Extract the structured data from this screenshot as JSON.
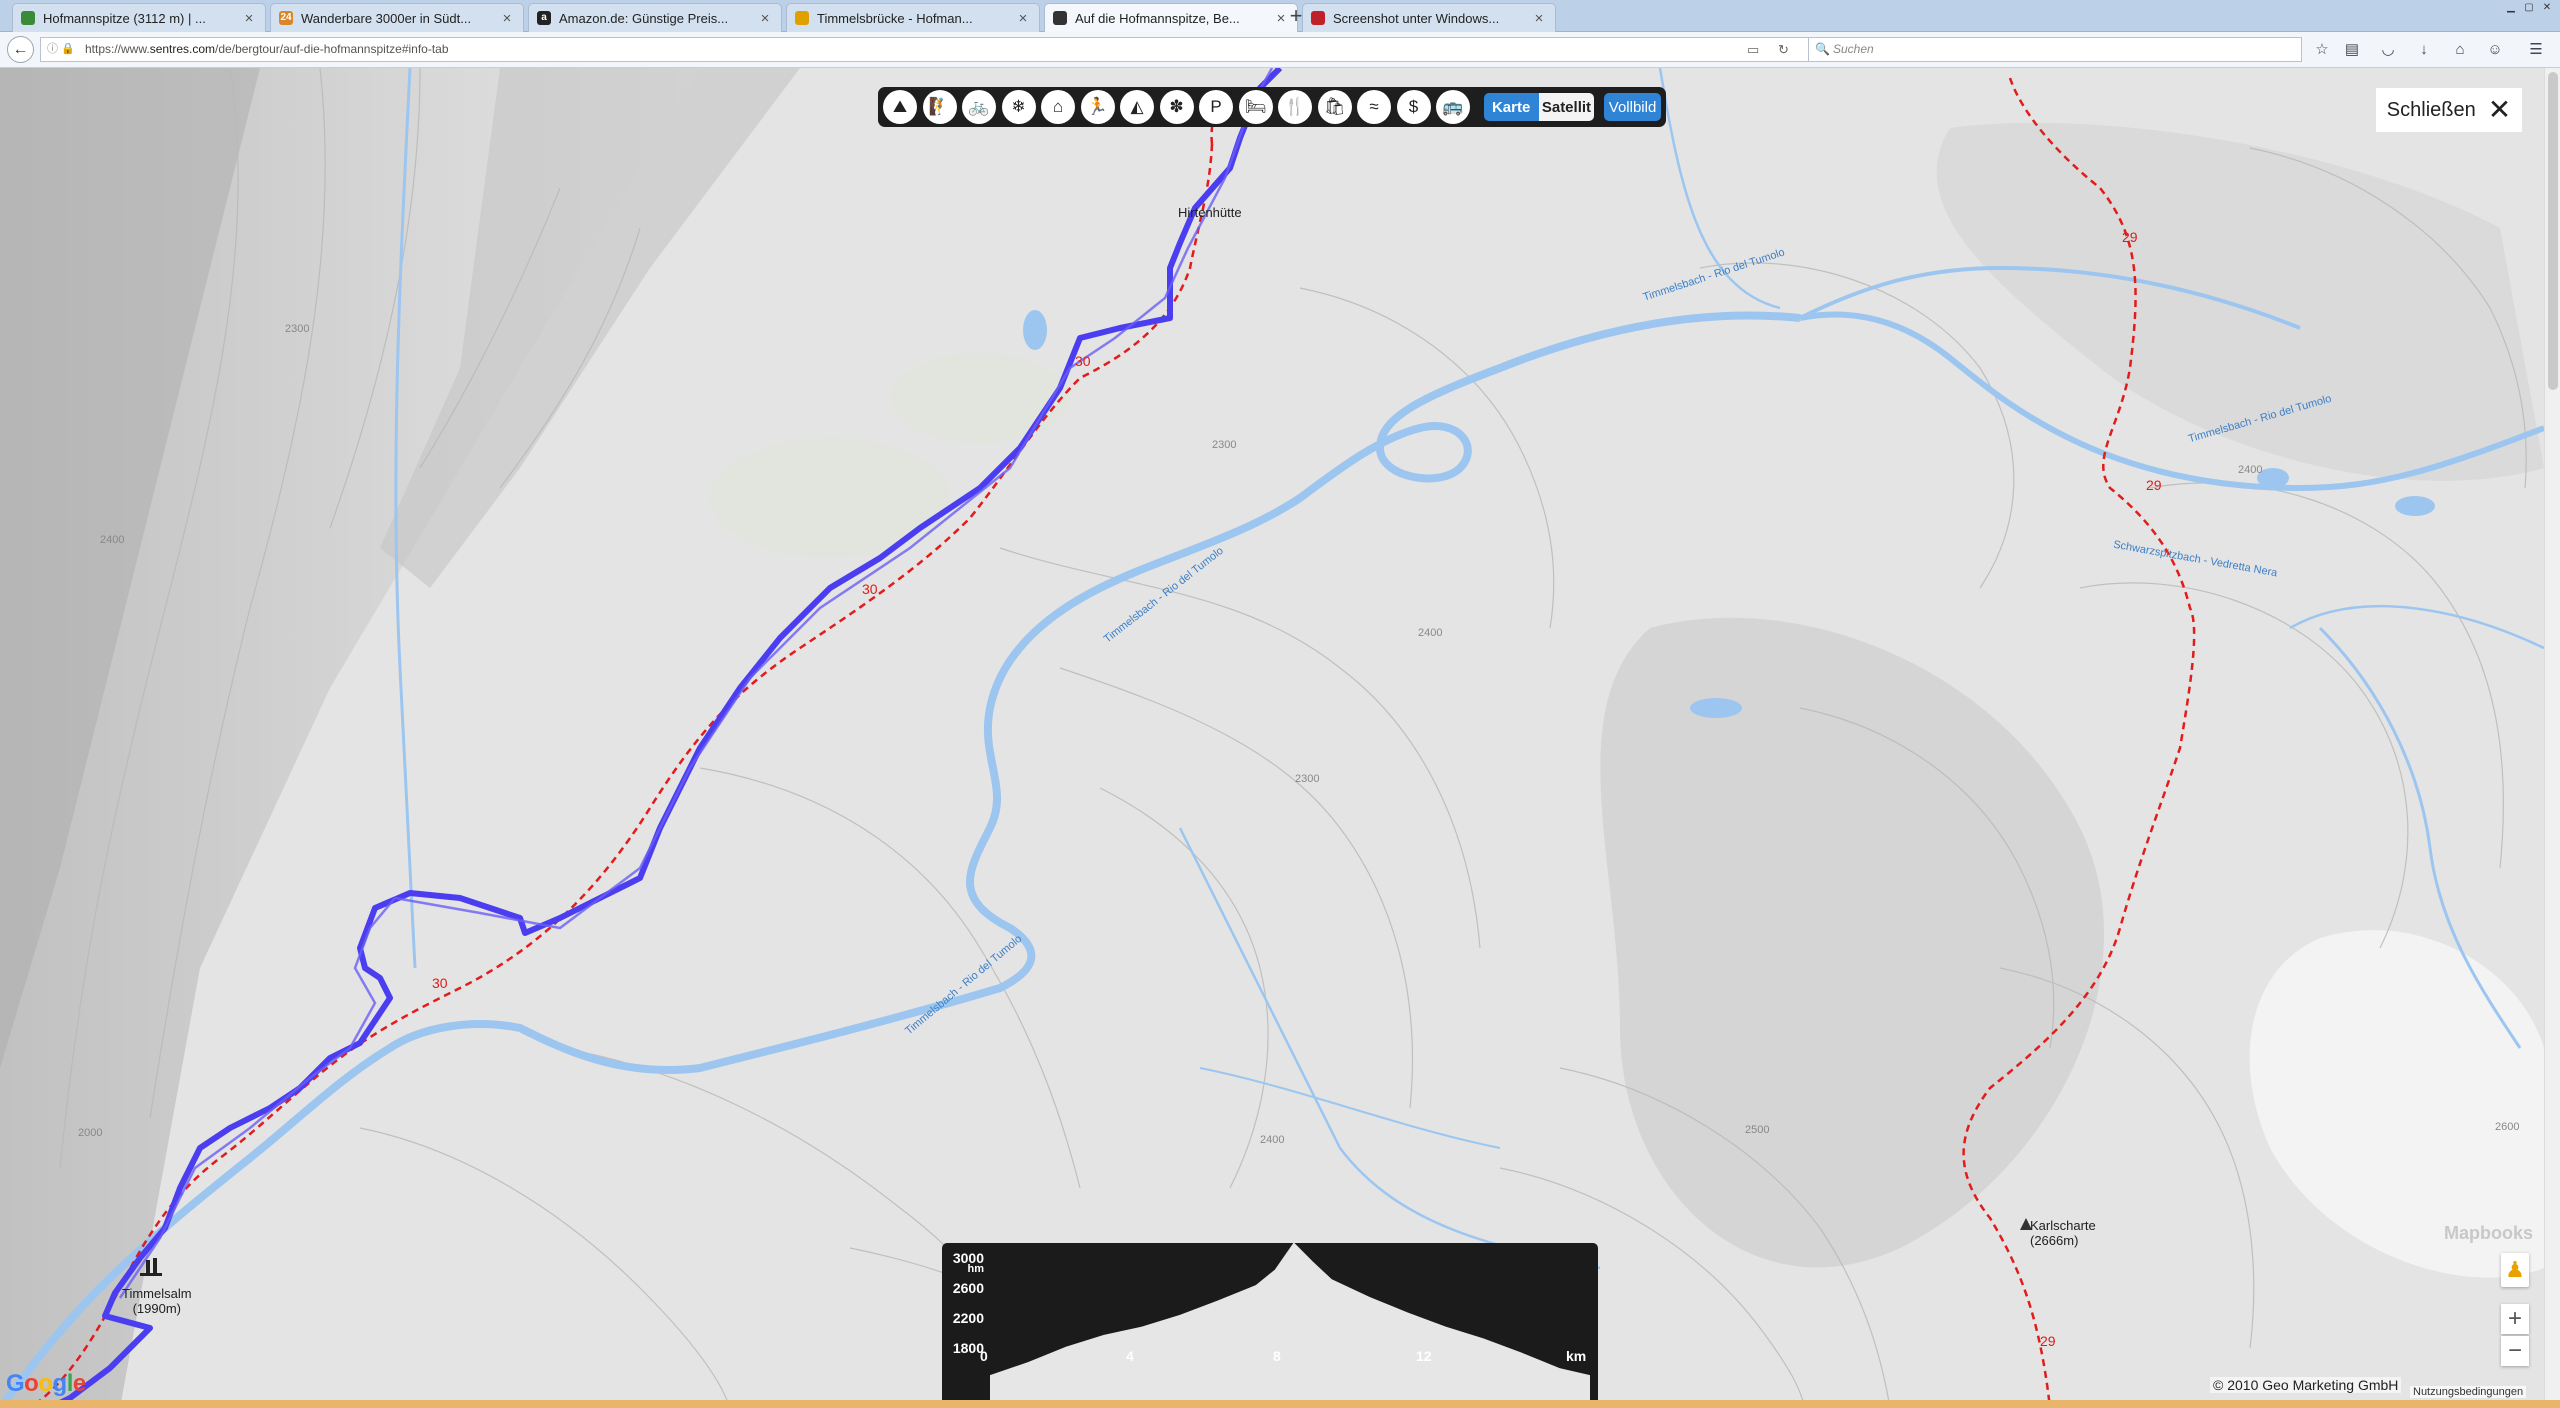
{
  "tabs": [
    {
      "title": "Hofmannspitze (3112 m) | ...",
      "favicon_color": "#3a8a3a",
      "active": false
    },
    {
      "title": "Wanderbare 3000er in Südt...",
      "favicon_color": "#d9862a",
      "favicon_glyph": "24",
      "active": false
    },
    {
      "title": "Amazon.de: Günstige Preis...",
      "favicon_color": "#222222",
      "favicon_glyph": "a",
      "active": false
    },
    {
      "title": "Timmelsbrücke - Hofman...",
      "favicon_color": "#e0a000",
      "active": false
    },
    {
      "title": "Auf die Hofmannspitze, Be...",
      "favicon_color": "#333333",
      "active": true
    },
    {
      "title": "Screenshot unter Windows...",
      "favicon_color": "#c0202a",
      "active": false
    }
  ],
  "tab_close_glyph": "×",
  "new_tab_glyph": "+",
  "nav": {
    "url_plain_prefix": "https://www.",
    "url_domain": "sentres.com",
    "url_path": "/de/bergtour/auf-die-hofmannspitze#info-tab",
    "search_placeholder": "Suchen"
  },
  "map_modes": [
    {
      "name": "mode-wandern-icon",
      "glyph": "⛰"
    },
    {
      "name": "mode-klettern-icon",
      "glyph": "🧗"
    },
    {
      "name": "mode-radfahren-icon",
      "glyph": "🚲"
    },
    {
      "name": "mode-winter-icon",
      "glyph": "❄"
    },
    {
      "name": "mode-huette-icon",
      "glyph": "⌂"
    },
    {
      "name": "mode-laufen-icon",
      "glyph": "🏃"
    },
    {
      "name": "mode-gipfel-icon",
      "glyph": "◭"
    },
    {
      "name": "mode-aussicht-icon",
      "glyph": "✽"
    },
    {
      "name": "mode-parken-icon",
      "glyph": "P"
    },
    {
      "name": "mode-unterkunft-icon",
      "glyph": "🛏"
    },
    {
      "name": "mode-essen-icon",
      "glyph": "🍴"
    },
    {
      "name": "mode-shopping-icon",
      "glyph": "🛍"
    },
    {
      "name": "mode-baden-icon",
      "glyph": "≈"
    },
    {
      "name": "mode-geld-icon",
      "glyph": "$"
    },
    {
      "name": "mode-bus-icon",
      "glyph": "🚌"
    }
  ],
  "map_type": {
    "karte": "Karte",
    "satellit": "Satellit",
    "vollbild": "Vollbild"
  },
  "close": {
    "label": "Schließen",
    "glyph": "✕"
  },
  "labels": {
    "hirtenhuette": "Hirtenhütte",
    "timmelsalm_name": "Timmelsalm",
    "timmelsalm_elev": "(1990m)",
    "karlscharte_name": "Karlscharte",
    "karlscharte_elev": "(2666m)",
    "route_30_a": "30",
    "route_30_b": "30",
    "route_30_c": "30",
    "route_29_a": "29",
    "route_29_b": "29",
    "route_29_c": "29",
    "stream_timmelsbach_1": "Timmelsbach - Rio del Tumolo",
    "stream_timmelsbach_2": "Timmelsbach - Rio del Tumolo",
    "stream_timmelsbach_3": "Timmelsbach - Rio del Tumolo",
    "stream_timmelsbach_4": "Timmelsbach - Rio del Tumolo",
    "stream_schwarz": "Schwarzspitzbach - Vedretta Nera",
    "contour_1": "2300",
    "contour_2": "2400",
    "contour_3": "2300",
    "contour_4": "2400",
    "contour_5": "2400",
    "contour_6": "2000",
    "contour_7": "2300",
    "contour_8": "2400",
    "contour_9": "2500",
    "contour_10": "2600"
  },
  "elevation_profile": {
    "unit_y": "hm",
    "unit_x": "km",
    "y_ticks": [
      "3000",
      "2600",
      "2200",
      "1800"
    ],
    "x_ticks": [
      "0",
      "4",
      "8",
      "12",
      "km"
    ],
    "chart_data": {
      "type": "area",
      "x": [
        0,
        1,
        2,
        3,
        4,
        5,
        6,
        7,
        7.5,
        8,
        8.5,
        9,
        10,
        11,
        12,
        13,
        14,
        15,
        15.8
      ],
      "y": [
        1990,
        2100,
        2230,
        2330,
        2400,
        2500,
        2620,
        2750,
        2880,
        3112,
        2950,
        2800,
        2650,
        2520,
        2400,
        2300,
        2180,
        2050,
        1990
      ],
      "ylim": [
        1700,
        3000
      ],
      "xlim": [
        0,
        15.8
      ]
    }
  },
  "copyright": "© 2010 Geo Marketing GmbH",
  "terms": "Nutzungsbedingungen",
  "google": "Google",
  "watermark": "Mapbooks",
  "zoom_in": "+",
  "zoom_out": "−",
  "colors": {
    "track": "#4b3df0",
    "route": "#e21b1b",
    "water": "#9cc6ef",
    "accent_button": "#2f84d6"
  }
}
